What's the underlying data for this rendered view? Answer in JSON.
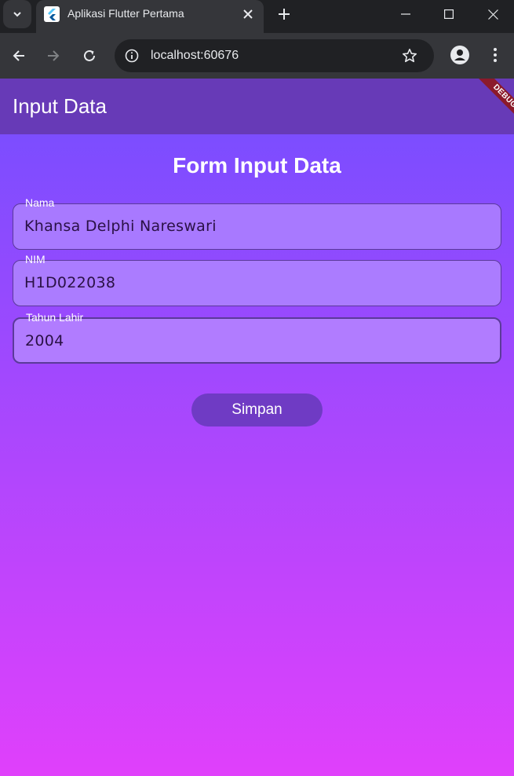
{
  "browser": {
    "tab_title": "Aplikasi Flutter Pertama",
    "url": "localhost:60676"
  },
  "app": {
    "appbar_title": "Input Data",
    "debug_label": "DEBUG",
    "form_title": "Form Input Data",
    "fields": [
      {
        "label": "Nama",
        "value": "Khansa Delphi Nareswari"
      },
      {
        "label": "NIM",
        "value": "H1D022038"
      },
      {
        "label": "Tahun Lahir",
        "value": "2004"
      }
    ],
    "save_label": "Simpan"
  },
  "colors": {
    "appbar": "#673ab7",
    "gradient_top": "#7c4dff",
    "gradient_bottom": "#e040fb",
    "button": "#6f3bc4"
  },
  "icons": [
    "tab-search-icon",
    "flutter-favicon-icon",
    "close-icon",
    "plus-icon",
    "minimize-icon",
    "maximize-icon",
    "window-close-icon",
    "back-arrow-icon",
    "forward-arrow-icon",
    "reload-icon",
    "info-icon",
    "star-icon",
    "profile-icon",
    "kebab-menu-icon"
  ]
}
